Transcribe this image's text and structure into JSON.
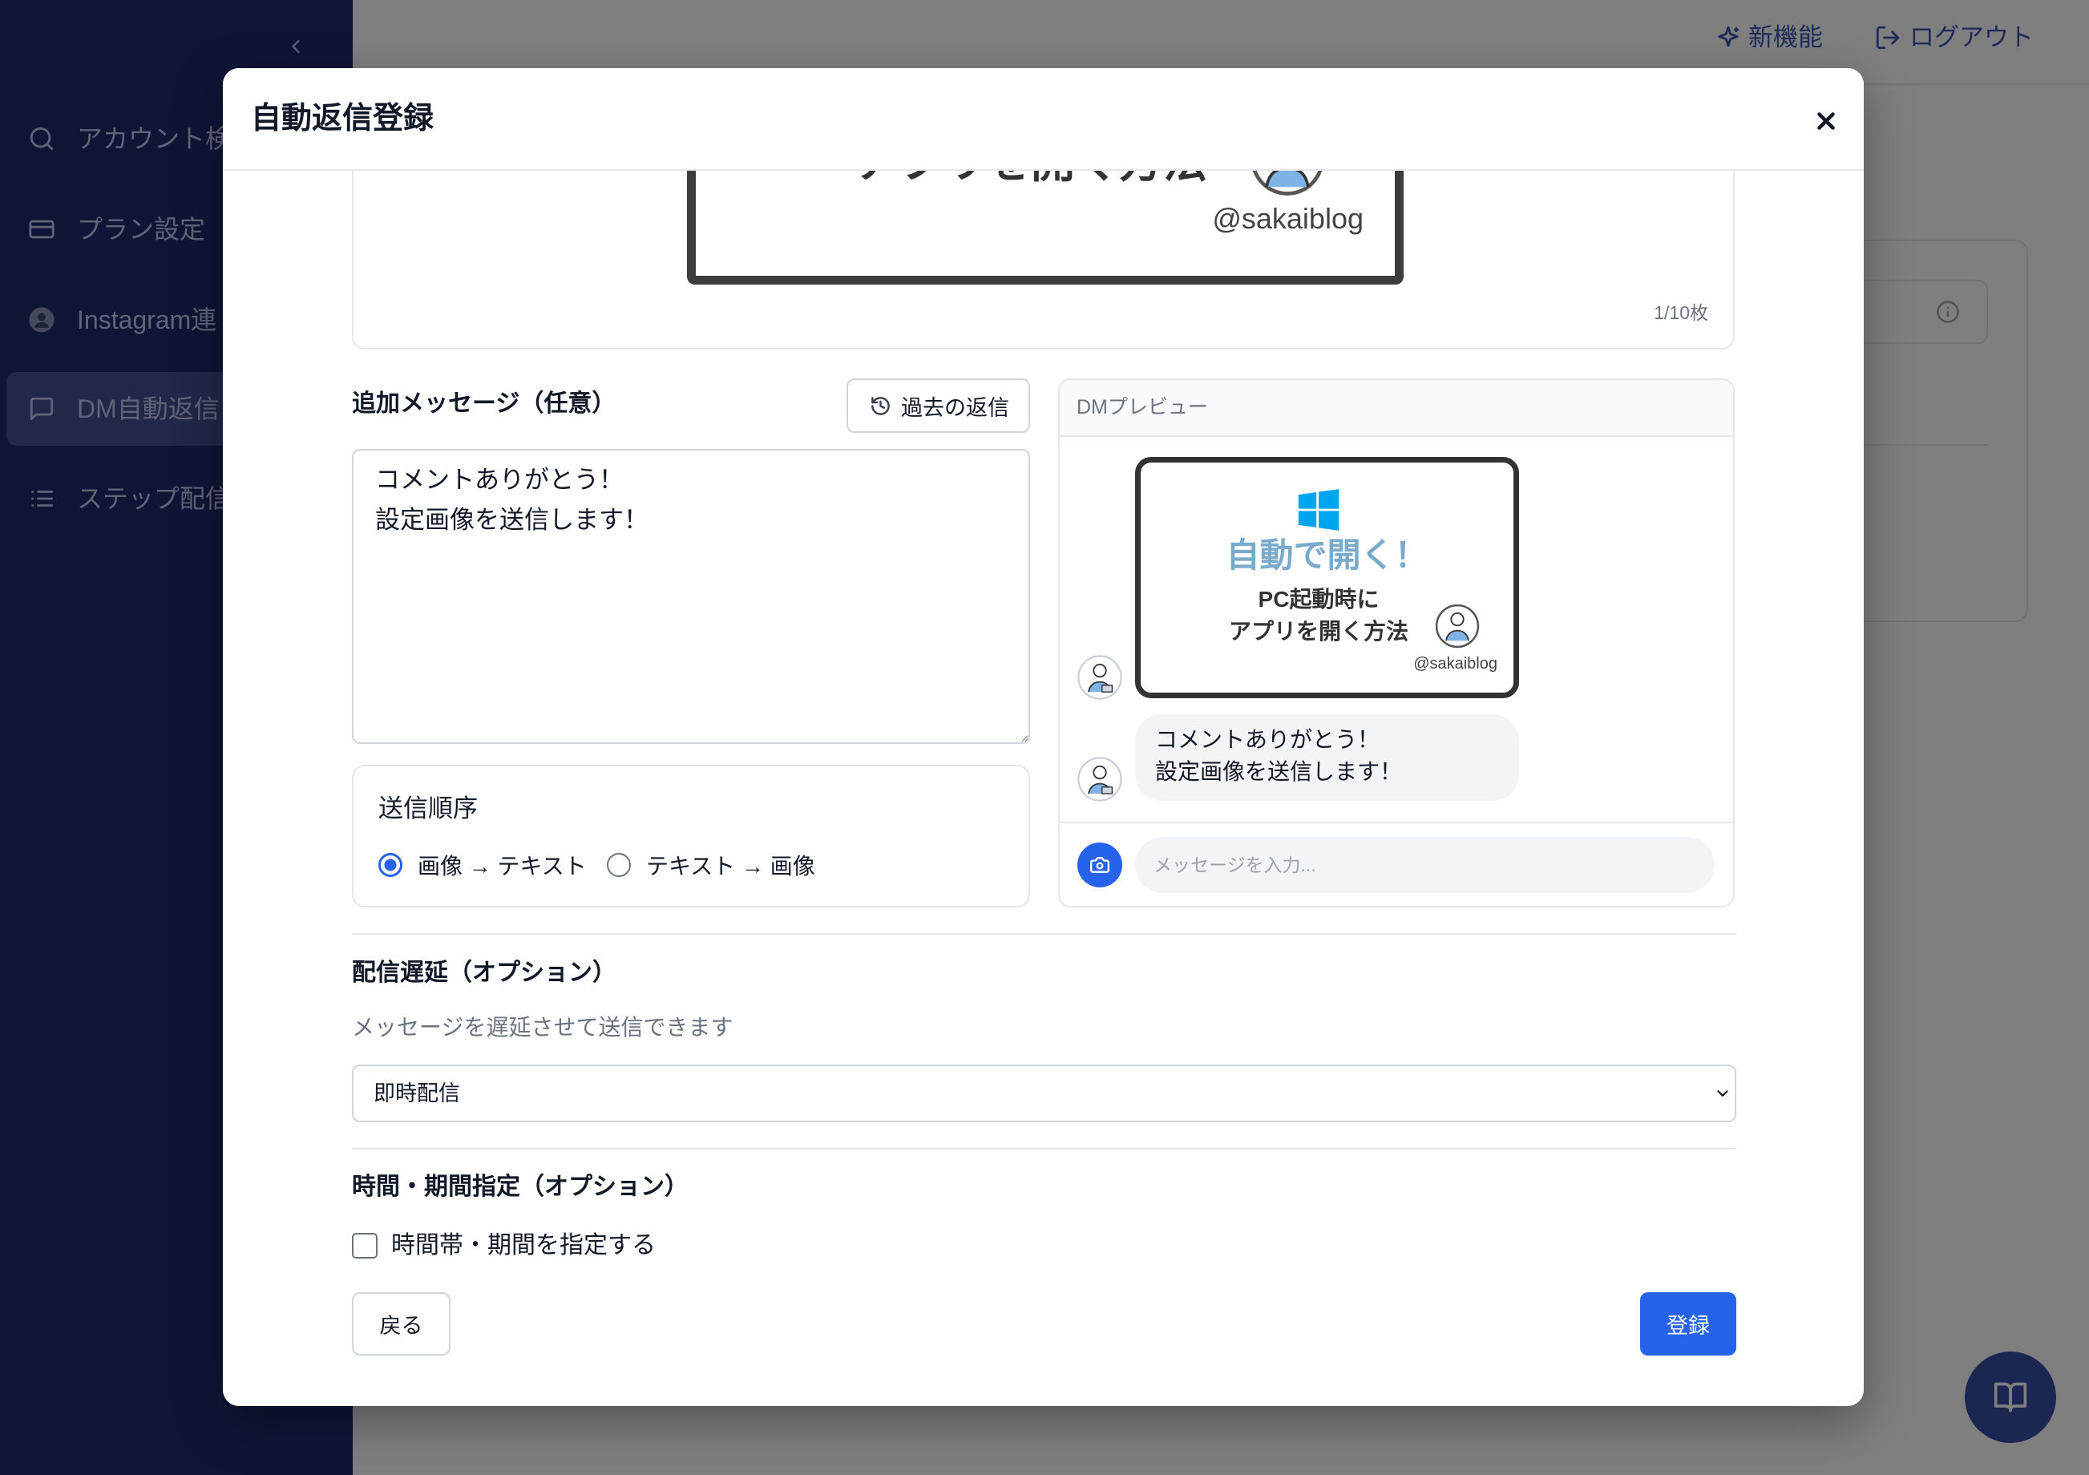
{
  "topbar": {
    "new_features_label": "新機能",
    "logout_label": "ログアウト"
  },
  "sidebar": {
    "items": [
      {
        "label": "アカウント検",
        "icon": "search-icon",
        "active": false
      },
      {
        "label": "プラン設定",
        "icon": "credit-card-icon",
        "active": false
      },
      {
        "label": "Instagram連",
        "icon": "profile-avatar-icon",
        "active": false
      },
      {
        "label": "DM自動返信",
        "icon": "message-square-icon",
        "active": true
      },
      {
        "label": "ステップ配信",
        "icon": "list-icon",
        "active": false
      }
    ]
  },
  "modal": {
    "title": "自動返信登録",
    "image_upload": {
      "image_title": "アプリを開く方法",
      "image_handle": "@sakaiblog",
      "count": "1/10枚"
    },
    "additional_message": {
      "label": "追加メッセージ（任意）",
      "history_button": "過去の返信",
      "value": "コメントありがとう！\n設定画像を送信します！"
    },
    "send_order": {
      "label": "送信順序",
      "options": [
        {
          "label": "画像 → テキスト",
          "selected": true
        },
        {
          "label": "テキスト → 画像",
          "selected": false
        }
      ]
    },
    "dm_preview": {
      "header": "DMプレビュー",
      "image": {
        "headline": "自動で開く！",
        "line1": "PC起動時に",
        "line2": "アプリを開く方法",
        "handle": "@sakaiblog"
      },
      "message": "コメントありがとう！\n設定画像を送信します！",
      "input_placeholder": "メッセージを入力..."
    },
    "delivery_delay": {
      "heading": "配信遅延（オプション）",
      "description": "メッセージを遅延させて送信できます",
      "selected": "即時配信"
    },
    "schedule": {
      "heading": "時間・期間指定（オプション）",
      "checkbox_label": "時間帯・期間を指定する",
      "checked": false
    },
    "buttons": {
      "back": "戻る",
      "submit": "登録"
    }
  },
  "colors": {
    "accent": "#2563eb",
    "sidebar": "#1e2a6a",
    "overlay": "rgba(0,0,0,0.5)"
  }
}
